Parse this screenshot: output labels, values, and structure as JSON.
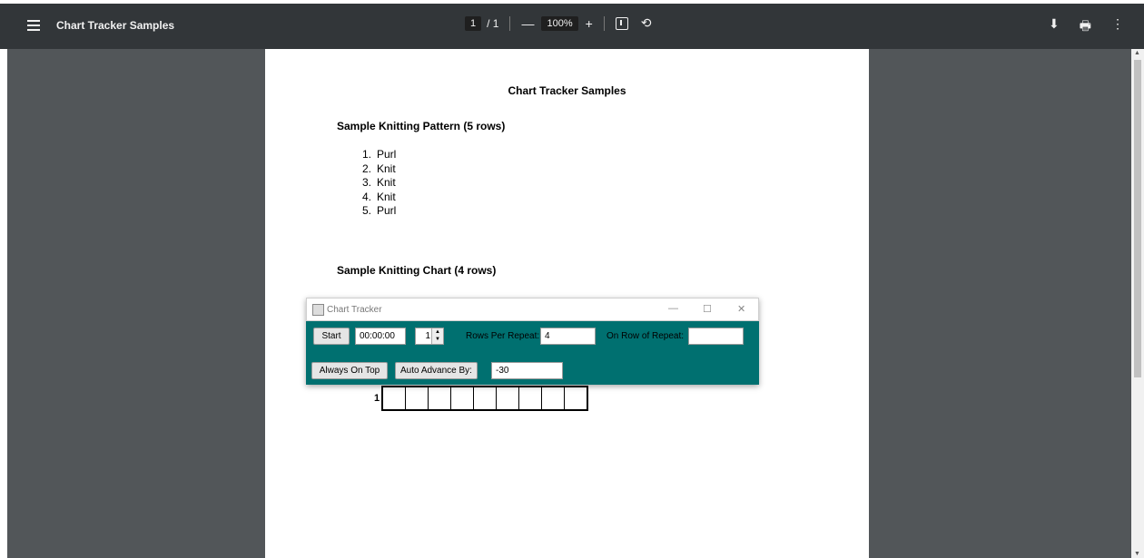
{
  "toolbar": {
    "title": "Chart Tracker Samples",
    "page_current": "1",
    "page_total": "/ 1",
    "zoom": "100%",
    "minus": "—",
    "plus": "+",
    "rotate": "⟲",
    "download": "⬇",
    "print": "🖶",
    "more": "⋮"
  },
  "document": {
    "heading": "Chart Tracker Samples",
    "pattern_title": "Sample Knitting Pattern (5 rows)",
    "pattern_rows": [
      {
        "num": "1.",
        "stitch": "Purl"
      },
      {
        "num": "2.",
        "stitch": "Knit"
      },
      {
        "num": "3.",
        "stitch": "Knit"
      },
      {
        "num": "4.",
        "stitch": "Knit"
      },
      {
        "num": "5.",
        "stitch": "Purl"
      }
    ],
    "chart_title": "Sample Knitting Chart (4 rows)",
    "chart_row_number": "1",
    "chart_cell_count": 9
  },
  "chart_tracker": {
    "title": "Chart Tracker",
    "minimize": "—",
    "maximize": "☐",
    "close": "✕",
    "start_label": "Start",
    "timer_value": "00:00:00",
    "spinner_value": "1",
    "rows_per_repeat_label": "Rows Per Repeat:",
    "rows_per_repeat_value": "4",
    "on_row_label": "On Row of Repeat:",
    "on_row_value": "",
    "always_on_top_label": "Always On Top",
    "auto_advance_label": "Auto Advance By:",
    "auto_advance_value": "-30"
  },
  "colors": {
    "toolbar_bg": "#323639",
    "viewer_bg": "#525659",
    "tracker_bg": "#007070"
  }
}
